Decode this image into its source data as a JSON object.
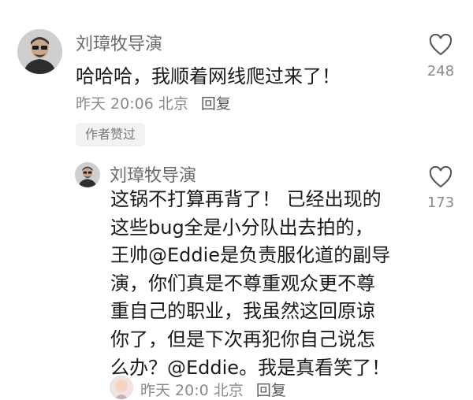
{
  "comment": {
    "username": "刘璋牧导演",
    "text": "哈哈哈，我顺着网线爬过来了！",
    "time": "昨天 20:06",
    "location": "北京",
    "reply_label": "回复",
    "likes": "248",
    "author_badge": "作者赞过"
  },
  "reply": {
    "username": "刘璋牧导演",
    "lines": [
      "这锅不打算再背了！ 已经出现的",
      "这些bug全是小分队出去拍的，",
      "王帅@Eddie是负责服化道的副导",
      "演，你们真是不尊重观众更不尊",
      "重自己的职业，我虽然这回原谅",
      "你了，但是下次再犯你自己说怎",
      "么办？@Eddie。我是真看笑了！"
    ],
    "time": "昨天 20:0",
    "location": "北京",
    "reply_label": "回复",
    "likes": "173"
  },
  "icons": {
    "like": "heart-outline-icon"
  },
  "colors": {
    "username": "#6b6b6b",
    "meta": "#8a8a8a",
    "badge_bg": "#f2f2f2"
  }
}
